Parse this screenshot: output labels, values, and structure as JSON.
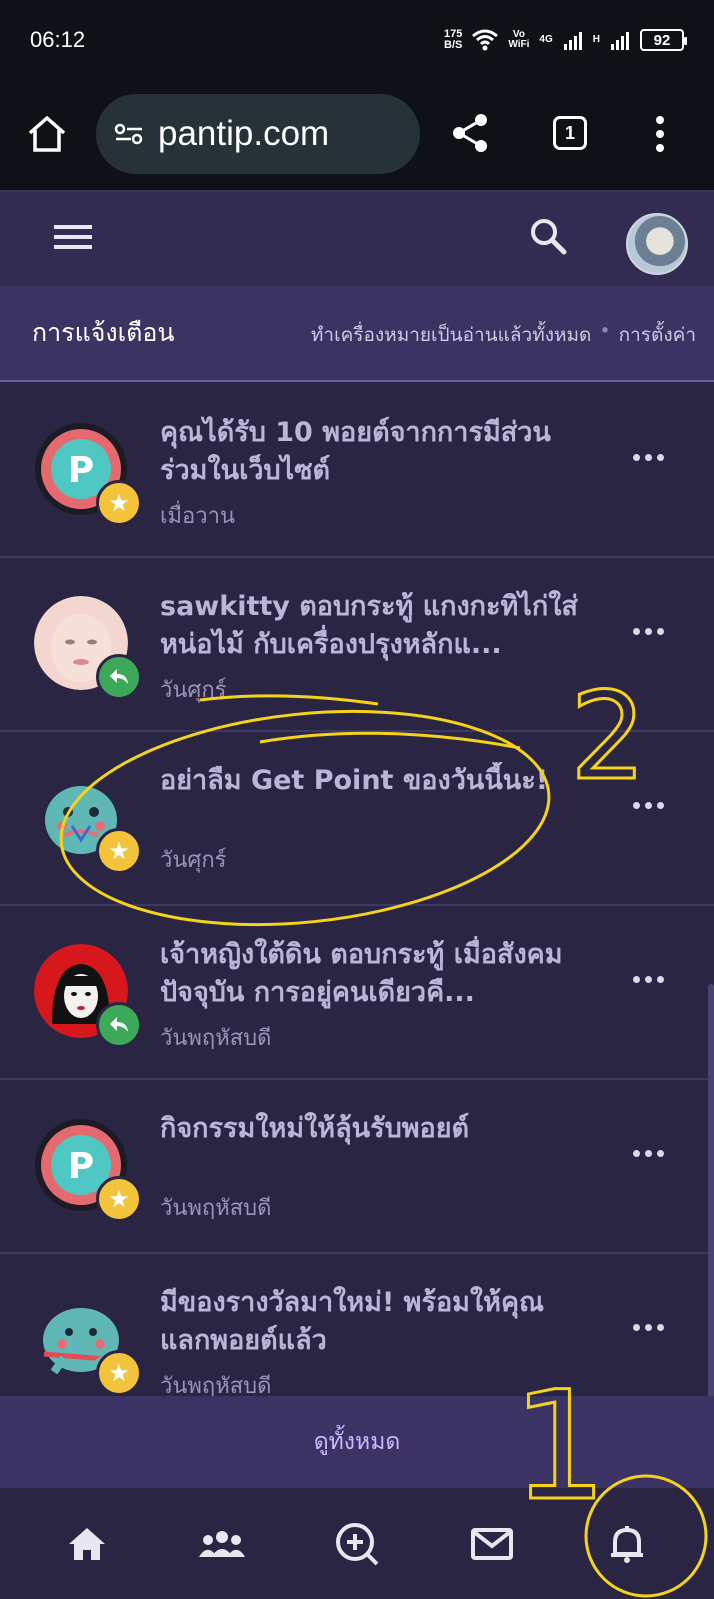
{
  "status_bar": {
    "time": "06:12",
    "net_speed_value": "175",
    "net_speed_unit": "B/S",
    "vowifi_top": "Vo",
    "vowifi_bottom": "WiFi",
    "network_4g": "4G",
    "network_h": "H",
    "battery": "92"
  },
  "browser": {
    "url": "pantip.com",
    "tab_count": "1"
  },
  "notifications_header": {
    "title": "การแจ้งเตือน",
    "mark_all_read": "ทำเครื่องหมายเป็นอ่านแล้วทั้งหมด",
    "separator": "•",
    "settings": "การตั้งค่า"
  },
  "notifications": [
    {
      "title": "คุณได้รับ 10 พอยต์จากการมีส่วนร่วมในเว็บไซต์",
      "time": "เมื่อวาน",
      "avatar": "point-coin-icon",
      "badge": "star"
    },
    {
      "title": "sawkitty ตอบกระทู้ แกงกะทิไก่ใส่หน่อไม้ กับเครื่องปรุงหลักแ...",
      "time": "วันศุกร์",
      "avatar": "user-photo",
      "badge": "reply"
    },
    {
      "title": "อย่าลืม Get Point ของวันนี้นะ!",
      "time": "วันศุกร์",
      "avatar": "mascot-icon",
      "badge": "star"
    },
    {
      "title": "เจ้าหญิงใต้ดิน ตอบกระทู้ เมื่อสังคมปัจจุบัน การอยู่คนเดียวคื...",
      "time": "วันพฤหัสบดี",
      "avatar": "user-cartoon",
      "badge": "reply"
    },
    {
      "title": "กิจกรรมใหม่ให้ลุ้นรับพอยต์",
      "time": "วันพฤหัสบดี",
      "avatar": "point-coin-icon",
      "badge": "star"
    },
    {
      "title": "มีของรางวัลมาใหม่! พร้อมให้คุณแลกพอยต์แล้ว",
      "time": "วันพฤหัสบดี",
      "avatar": "mascot-icon",
      "badge": "star"
    }
  ],
  "view_all": "ดูทั้งหมด",
  "bottom_nav": [
    "home-icon",
    "community-icon",
    "new-topic-icon",
    "mail-icon",
    "bell-icon"
  ],
  "annotation_labels": [
    "1",
    "2"
  ],
  "colors": {
    "background": "#2b2544",
    "header": "#332c52",
    "notif_bar": "#3b3463",
    "annotation": "#f5d21b",
    "star_badge": "#f2c33b",
    "reply_badge": "#3ca95a"
  }
}
